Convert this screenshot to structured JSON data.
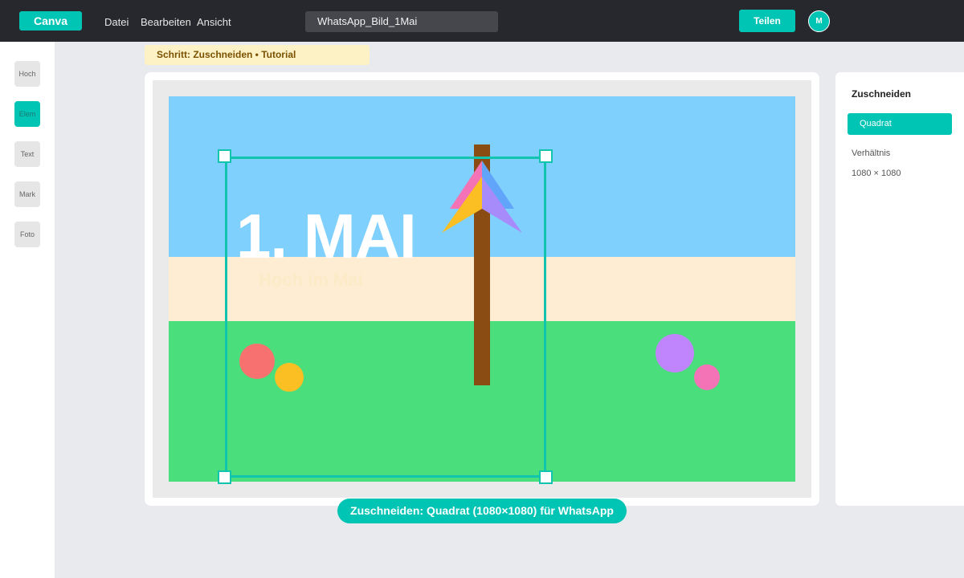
{
  "app": {
    "logo": "Canva",
    "menu": [
      "Datei",
      "Bearbeiten",
      "Ansicht"
    ],
    "document_title": "WhatsApp_Bild_1Mai",
    "share_label": "Teilen",
    "avatar_initial": "M"
  },
  "sidebar": {
    "items": [
      {
        "label": "Hoch",
        "active": false
      },
      {
        "label": "Elem",
        "active": true
      },
      {
        "label": "Text",
        "active": false
      },
      {
        "label": "Mark",
        "active": false
      },
      {
        "label": "Foto",
        "active": false
      }
    ]
  },
  "tutorial": {
    "label": "Schritt: Zuschneiden • Tutorial"
  },
  "artwork": {
    "title": "1. MAI",
    "subtitle": "Hoch im Mai",
    "colors": {
      "sky": "#7fd0fc",
      "sand": "#feecd3",
      "grass": "#4ade7c",
      "pole": "#8a4c12"
    }
  },
  "caption": {
    "text": "Zuschneiden: Quadrat (1080×1080) für WhatsApp"
  },
  "panel": {
    "title": "Zuschneiden",
    "selected_option": "Quadrat",
    "ratio_label": "Verhältnis",
    "dimensions": "1080 × 1080"
  },
  "colors": {
    "accent": "#00c4b4",
    "topbar": "#27282d",
    "tutorial_bg": "#fdf1c6"
  }
}
